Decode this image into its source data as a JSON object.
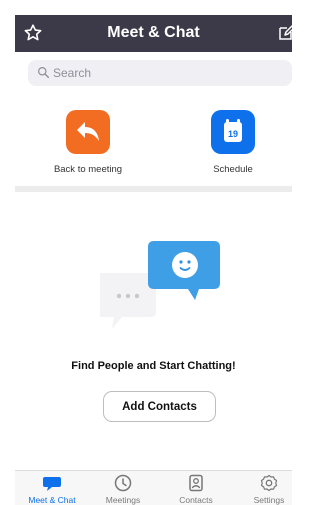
{
  "colors": {
    "header_background": "#3c3a49",
    "accent": "#0e71eb",
    "orange": "#f26d21",
    "divider": "#ececec",
    "search_background": "#efeff4"
  },
  "header": {
    "title": "Meet & Chat",
    "left_icon": "star-icon",
    "right_icon": "compose-icon"
  },
  "search": {
    "placeholder": "Search",
    "value": "",
    "icon": "search-icon"
  },
  "quick_actions": [
    {
      "label": "Back to meeting",
      "icon": "back-arrow-icon"
    },
    {
      "label": "Schedule",
      "icon": "calendar-icon",
      "calendar_day": "19"
    }
  ],
  "empty_state": {
    "title": "Find People and Start Chatting!",
    "button": "Add Contacts",
    "illustration": "chat-bubbles-illustration"
  },
  "tabs": [
    {
      "label": "Meet & Chat",
      "icon": "chat-bubble-icon",
      "active": true
    },
    {
      "label": "Meetings",
      "icon": "clock-icon",
      "active": false
    },
    {
      "label": "Contacts",
      "icon": "contact-icon",
      "active": false
    },
    {
      "label": "Settings",
      "icon": "gear-icon",
      "active": false
    }
  ]
}
